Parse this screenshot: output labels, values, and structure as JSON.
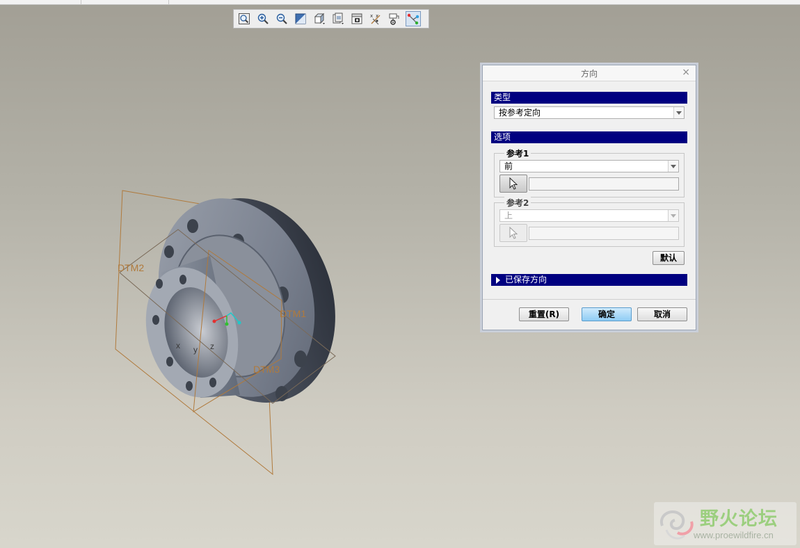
{
  "toolbar": {
    "buttons": [
      {
        "name": "refit",
        "icon": "zoom-fit-icon"
      },
      {
        "name": "zoom-in",
        "icon": "zoom-in-icon"
      },
      {
        "name": "zoom-out",
        "icon": "zoom-out-icon"
      },
      {
        "name": "repaint",
        "icon": "repaint-icon"
      },
      {
        "name": "display-style",
        "icon": "shaded-cube-icon"
      },
      {
        "name": "saved-views",
        "icon": "saved-views-icon"
      },
      {
        "name": "view-manager",
        "icon": "view-manager-icon"
      },
      {
        "name": "datum-display",
        "icon": "datum-planes-icon"
      },
      {
        "name": "annotation-display",
        "icon": "annotation-display-icon"
      },
      {
        "name": "orient",
        "icon": "orient-icon",
        "active": true
      }
    ]
  },
  "model": {
    "datums": [
      "DTM1",
      "DTM2",
      "DTM3"
    ],
    "csys_axes": [
      "x",
      "y",
      "z"
    ],
    "part_color": "#7b8290",
    "datum_color": "#b07a3c"
  },
  "dialog": {
    "title": "方向",
    "close": "×",
    "type_section": "类型",
    "type_value": "按参考定向",
    "options_section": "选项",
    "ref1": {
      "label": "参考1",
      "value": "前",
      "collector": ""
    },
    "ref2": {
      "label": "参考2",
      "value": "上",
      "collector": ""
    },
    "default_button": "默认",
    "saved_views_section": "已保存方向",
    "reset_button": "重置(R)",
    "ok_button": "确定",
    "cancel_button": "取消",
    "section_color": "#000080"
  },
  "watermark": {
    "title": "野火论坛",
    "url": "www.proewildfire.cn"
  }
}
